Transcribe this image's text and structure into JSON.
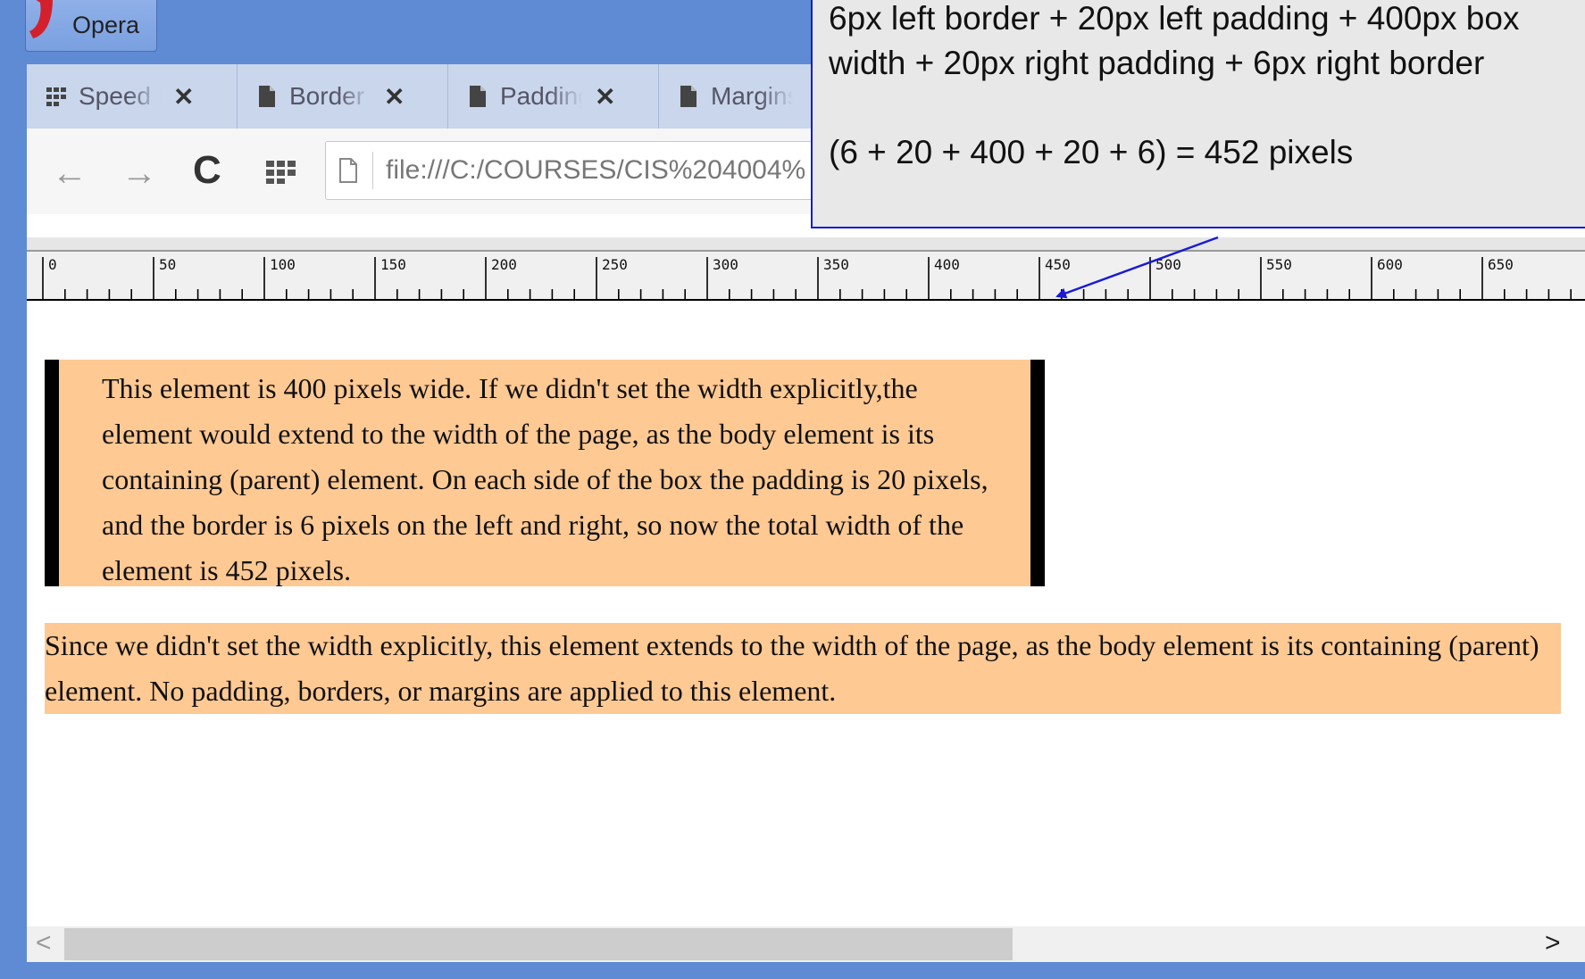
{
  "window": {
    "app_button_label": "Opera"
  },
  "tabs": [
    {
      "label": "Speed Dial",
      "icon": "grid-icon"
    },
    {
      "label": "Border Settings",
      "icon": "page-icon"
    },
    {
      "label": "Padding",
      "icon": "page-icon"
    },
    {
      "label": "Margins",
      "icon": "page-icon"
    }
  ],
  "toolbar": {
    "back_icon": "←",
    "forward_icon": "→",
    "reload_icon": "C",
    "url": "file:///C:/COURSES/CIS%204004%"
  },
  "ruler": {
    "labels": [
      "0",
      "50",
      "100",
      "150",
      "200",
      "250",
      "300",
      "350",
      "400",
      "450",
      "500",
      "550",
      "600",
      "650"
    ]
  },
  "content": {
    "box1_text": "This element is 400 pixels wide. If we didn't set the width explicitly,the element would extend to the width of the page, as the body element is its containing (parent) element. On each side of the box the padding is 20 pixels, and the border is 6 pixels on the left and right, so now the total width of the element is 452 pixels.",
    "box2_text": "Since we didn't set the width explicitly, this element extends to the width of the page, as the body element is its containing (parent) element. No padding, borders, or margins are applied to this element."
  },
  "callout": {
    "line1": "6px left border + 20px left padding + 400px box width + 20px right padding + 6px right border",
    "line2": "(6 + 20 + 400 + 20 + 6) = 452 pixels"
  },
  "colors": {
    "frame": "#5f8ad4",
    "box_bg": "#ffc993",
    "callout_border": "#1a1ad6"
  }
}
